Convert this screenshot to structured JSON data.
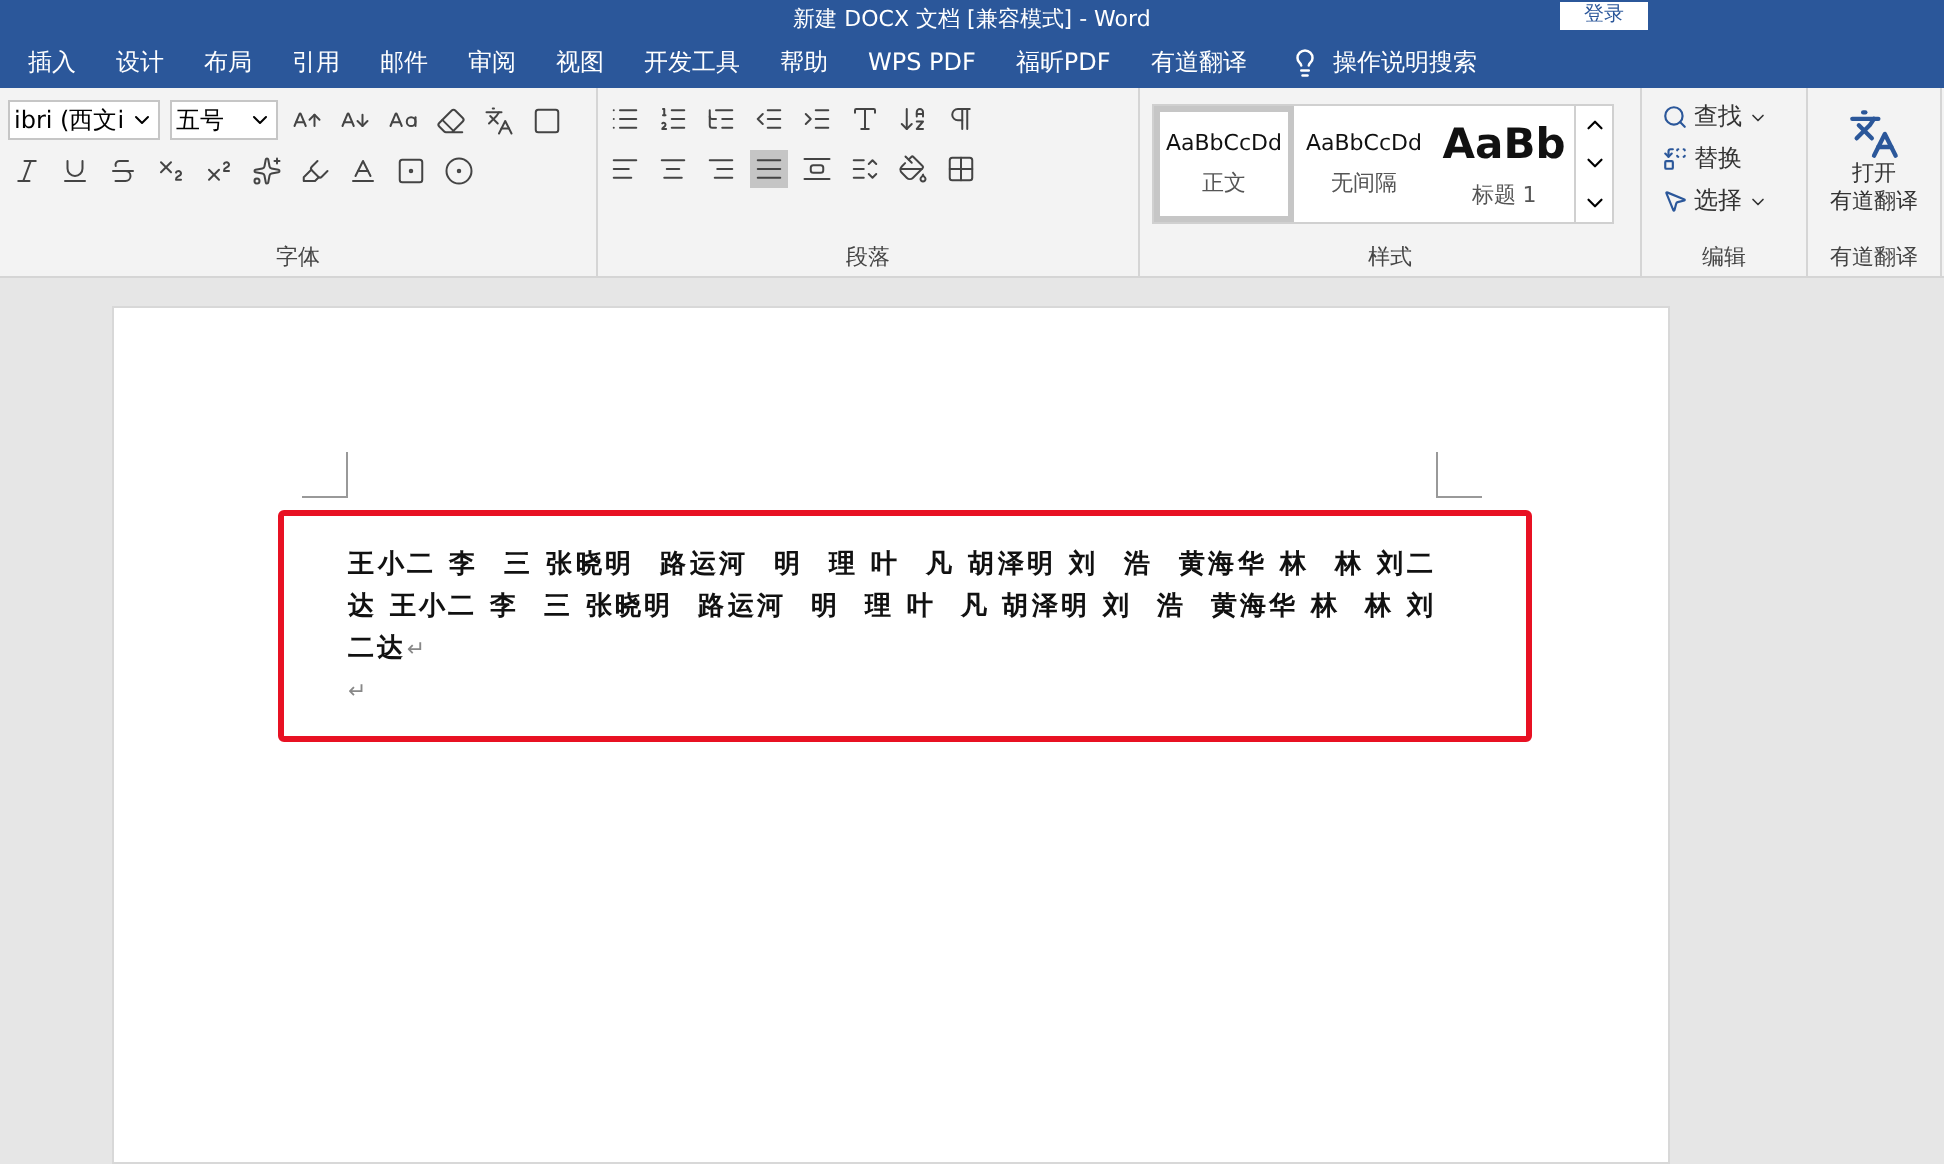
{
  "window": {
    "title": "新建 DOCX 文档 [兼容模式] - Word",
    "login": "登录"
  },
  "tabs": [
    "插入",
    "设计",
    "布局",
    "引用",
    "邮件",
    "审阅",
    "视图",
    "开发工具",
    "帮助",
    "WPS PDF",
    "福昕PDF",
    "有道翻译"
  ],
  "tell_me": "操作说明搜索",
  "ribbon": {
    "font": {
      "label": "字体",
      "font_name": "ibri (西文i",
      "font_size": "五号"
    },
    "paragraph": {
      "label": "段落",
      "alignment": [
        {
          "kind": "left",
          "selected": false
        },
        {
          "kind": "center",
          "selected": false
        },
        {
          "kind": "right",
          "selected": false
        },
        {
          "kind": "justify",
          "selected": true
        },
        {
          "kind": "distributed",
          "selected": false
        }
      ]
    },
    "styles": {
      "label": "样式",
      "items": [
        {
          "preview": "AaBbCcDd",
          "name": "正文",
          "kind": "normal",
          "selected": true
        },
        {
          "preview": "AaBbCcDd",
          "name": "无间隔",
          "kind": "normal",
          "selected": false
        },
        {
          "preview": "AaBb",
          "name": "标题 1",
          "kind": "heading",
          "selected": false
        }
      ]
    },
    "editing": {
      "label": "编辑",
      "items": [
        {
          "kind": "find",
          "label": "查找",
          "dropdown": true
        },
        {
          "kind": "replace",
          "label": "替换",
          "dropdown": false
        },
        {
          "kind": "select",
          "label": "选择",
          "dropdown": true
        }
      ]
    },
    "youdao": {
      "label": "有道翻译",
      "button_lines": [
        "打开",
        "有道翻译"
      ]
    }
  },
  "document": {
    "paragraphs": [
      {
        "text": "王小二 李  三 张晓明  路运河  明  理 叶  凡 胡泽明 刘  浩  黄海华 林  林 刘二达 王小二 李  三 张晓明  路运河  明  理 叶  凡 胡泽明 刘  浩  黄海华 林  林 刘二达",
        "mark": "↵"
      },
      {
        "mark": "↵"
      }
    ]
  }
}
